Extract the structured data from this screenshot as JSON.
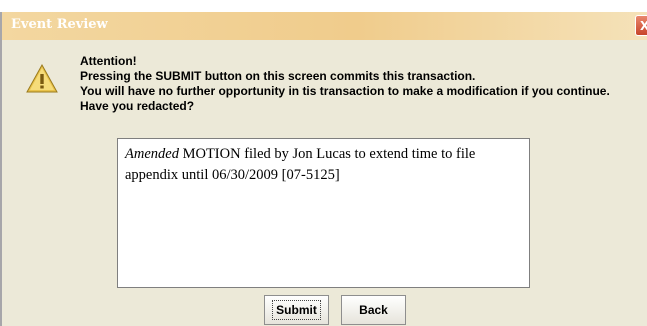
{
  "window": {
    "title": "Event Review",
    "close_glyph": "X"
  },
  "icons": {
    "warning": "warning-triangle-icon",
    "close": "close-icon"
  },
  "message": {
    "heading": "Attention!",
    "line1": "Pressing the SUBMIT button on this screen commits this transaction.",
    "line2": "You will have no further opportunity in tis transaction to make a modification if you continue.",
    "line3": "Have you redacted?"
  },
  "docket_text": {
    "italic_prefix": "Amended",
    "body": " MOTION filed by Jon Lucas to extend time to file appendix until 06/30/2009 [07-5125]"
  },
  "buttons": {
    "submit_label": "Submit",
    "back_label": "Back"
  },
  "colors": {
    "dialog_bg": "#ece9d8",
    "titlebar": "#f0cc8c",
    "close_red": "#c8452a",
    "warning_yellow": "#e8c24a"
  }
}
